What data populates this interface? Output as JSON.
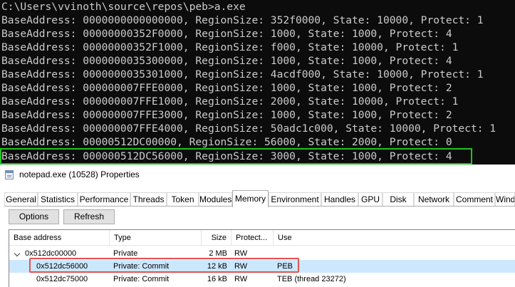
{
  "console": {
    "lines": [
      "C:\\Users\\vvinoth\\source\\repos\\peb>a.exe",
      "BaseAddress: 0000000000000000, RegionSize: 352f0000, State: 10000, Protect: 1",
      "BaseAddress: 00000000352F0000, RegionSize: 1000, State: 1000, Protect: 4",
      "BaseAddress: 00000000352F1000, RegionSize: f000, State: 10000, Protect: 1",
      "BaseAddress: 0000000035300000, RegionSize: 1000, State: 1000, Protect: 4",
      "BaseAddress: 0000000035301000, RegionSize: 4acdf000, State: 10000, Protect: 1",
      "BaseAddress: 000000007FFE0000, RegionSize: 1000, State: 1000, Protect: 2",
      "BaseAddress: 000000007FFE1000, RegionSize: 2000, State: 10000, Protect: 1",
      "BaseAddress: 000000007FFE3000, RegionSize: 1000, State: 1000, Protect: 2",
      "BaseAddress: 000000007FFE4000, RegionSize: 50adc1c000, State: 10000, Protect: 1",
      "BaseAddress: 00000512DC00000, RegionSize: 56000, State: 2000, Protect: 0",
      "BaseAddress: 000000512DC56000, RegionSize: 3000, State: 1000, Protect: 4"
    ]
  },
  "window": {
    "title": "notepad.exe (10528) Properties"
  },
  "tabs": [
    "General",
    "Statistics",
    "Performance",
    "Threads",
    "Token",
    "Modules",
    "Memory",
    "Environment",
    "Handles",
    "GPU",
    "Disk",
    "Network",
    "Comment",
    "Windo"
  ],
  "active_tab": "Memory",
  "buttons": {
    "options": "Options",
    "refresh": "Refresh"
  },
  "memory_list": {
    "columns": [
      "Base address",
      "Type",
      "Size",
      "Protect...",
      "Use"
    ],
    "rows": [
      {
        "base": "0x512dc00000",
        "type": "Private",
        "size": "2 MB",
        "protect": "RW",
        "use": ""
      },
      {
        "base": "0x512dc56000",
        "type": "Private: Commit",
        "size": "12 kB",
        "protect": "RW",
        "use": "PEB"
      },
      {
        "base": "0x512dc75000",
        "type": "Private: Commit",
        "size": "16 kB",
        "protect": "RW",
        "use": "TEB (thread 23272)"
      }
    ]
  },
  "colors": {
    "console_bg": "#0c0c0c",
    "console_text": "#cccccc",
    "console_highlight": "#1ec41e",
    "row_highlight": "#e05252",
    "selection": "#cce8ff"
  }
}
